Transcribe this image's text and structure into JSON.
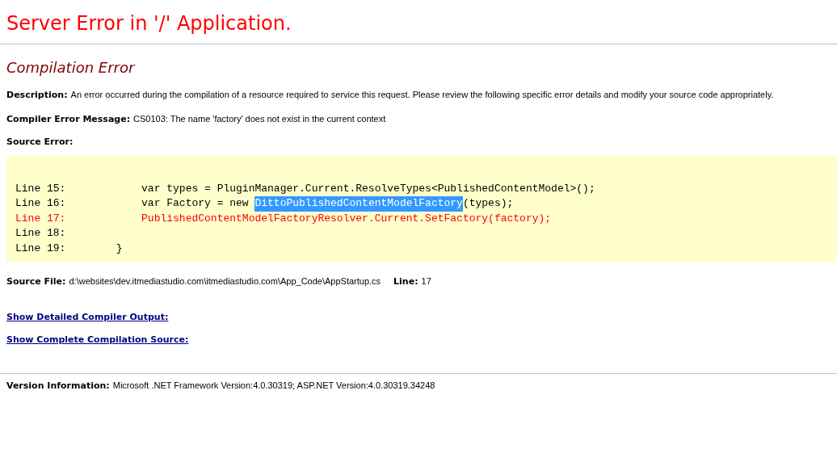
{
  "title": "Server Error in '/' Application.",
  "error_heading": "Compilation Error",
  "fields": [
    {
      "label": "Description:",
      "value": "An error occurred during the compilation of a resource required to service this request. Please review the following specific error details and modify your source code appropriately."
    },
    {
      "label": "Compiler Error Message:",
      "value": "CS0103: The name 'factory' does not exist in the current context"
    }
  ],
  "source_error": {
    "label": "Source Error:",
    "lines": [
      {
        "error": false,
        "segments": [
          {
            "text": "Line 15:            var types = PluginManager.Current.ResolveTypes<PublishedContentModel>();",
            "selected": false
          }
        ]
      },
      {
        "error": false,
        "segments": [
          {
            "text": "Line 16:            var Factory = new ",
            "selected": false
          },
          {
            "text": "DittoPublishedContentModelFactory",
            "selected": true
          },
          {
            "text": "(types);",
            "selected": false
          }
        ]
      },
      {
        "error": true,
        "segments": [
          {
            "text": "Line 17:            PublishedContentModelFactoryResolver.Current.SetFactory(factory);",
            "selected": false
          }
        ]
      },
      {
        "error": false,
        "segments": [
          {
            "text": "Line 18:",
            "selected": false
          }
        ]
      },
      {
        "error": false,
        "segments": [
          {
            "text": "Line 19:        }",
            "selected": false
          }
        ]
      }
    ]
  },
  "source_file": {
    "label": "Source File:",
    "value": "d:\\websites\\dev.itmediastudio.com\\itmediastudio.com\\App_Code\\AppStartup.cs",
    "line_label": "Line:",
    "line_value": "17"
  },
  "links": [
    "Show Detailed Compiler Output:",
    "Show Complete Compilation Source:"
  ],
  "version": {
    "label": "Version Information:",
    "value": "Microsoft .NET Framework Version:4.0.30319; ASP.NET Version:4.0.30319.34248"
  }
}
